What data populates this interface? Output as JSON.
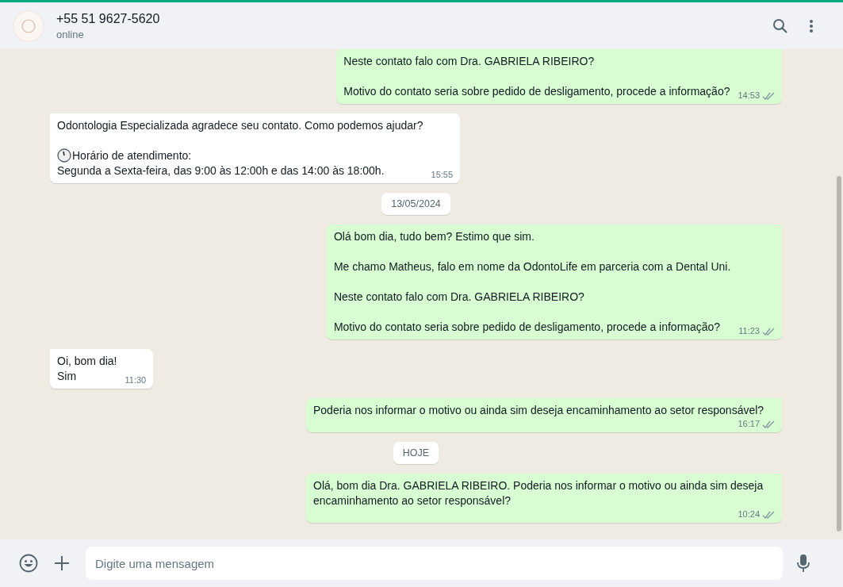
{
  "header": {
    "contact": "+55 51 9627-5620",
    "status": "online"
  },
  "chat": [
    {
      "kind": "outgoing",
      "paragraphs": [
        {
          "kind": "plain",
          "text": "Neste contato falo com Dra. GABRIELA RIBEIRO?"
        },
        {
          "kind": "plain",
          "text": "Motivo do contato seria sobre pedido de desligamento, procede a informação?"
        }
      ],
      "time": "14:53",
      "read": false
    },
    {
      "kind": "incoming",
      "paragraphs": [
        {
          "kind": "plain",
          "text": "Odontologia Especializada agradece seu contato. Como podemos ajudar?"
        },
        {
          "kind": "clock",
          "text": "Horário de atendimento:"
        },
        {
          "kind": "plain",
          "text": "Segunda a Sexta-feira, das 9:00 às 12:00h e das 14:00 às 18:00h."
        }
      ],
      "time": "15:55"
    },
    {
      "kind": "date",
      "text": "13/05/2024"
    },
    {
      "kind": "outgoing",
      "paragraphs": [
        {
          "kind": "plain",
          "text": "Olá bom dia, tudo bem? Estimo que sim."
        },
        {
          "kind": "plain",
          "text": "Me chamo Matheus, falo em nome da OdontoLife em parceria com a Dental Uni."
        },
        {
          "kind": "plain",
          "text": "Neste contato falo com Dra. GABRIELA RIBEIRO?"
        },
        {
          "kind": "plain",
          "text": "Motivo do contato seria sobre pedido de desligamento, procede a informação?"
        }
      ],
      "time": "11:23",
      "read": false
    },
    {
      "kind": "incoming",
      "paragraphs": [
        {
          "kind": "plain",
          "text": "Oi, bom dia!\nSim"
        }
      ],
      "time": "11:30"
    },
    {
      "kind": "outgoing",
      "paragraphs": [
        {
          "kind": "plain",
          "text": "Poderia nos informar o motivo ou ainda sim deseja encaminhamento ao setor responsável?"
        }
      ],
      "time": "16:17",
      "read": false
    },
    {
      "kind": "date",
      "text": "HOJE"
    },
    {
      "kind": "outgoing",
      "paragraphs": [
        {
          "kind": "plain",
          "text": "Olá, bom dia Dra. GABRIELA RIBEIRO. Poderia nos informar o motivo ou ainda sim deseja encaminhamento ao setor responsável?"
        }
      ],
      "time": "10:24",
      "read": false
    }
  ],
  "composer": {
    "placeholder": "Digite uma mensagem"
  }
}
